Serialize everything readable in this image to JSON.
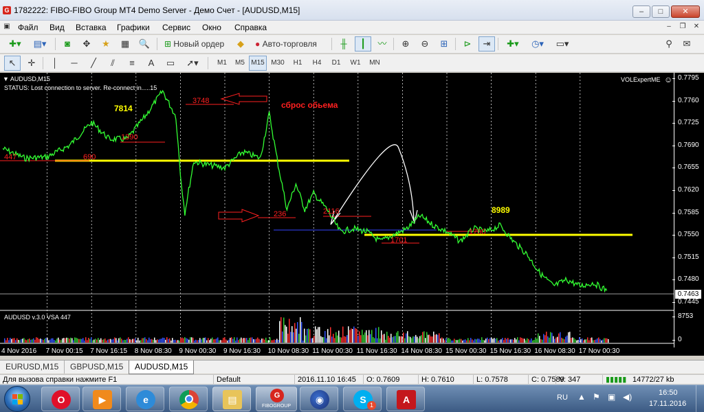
{
  "window": {
    "title": "1782222: FIBO-FIBO Group MT4 Demo Server - Демо Счет - [AUDUSD,M15]",
    "minimize": "–",
    "maximize": "□",
    "close": "✕"
  },
  "menu": [
    "Файл",
    "Вид",
    "Вставка",
    "Графики",
    "Сервис",
    "Окно",
    "Справка"
  ],
  "toolbar": {
    "new_order": "Новый ордер",
    "autotrading": "Авто-торговля",
    "timeframes": [
      "M1",
      "M5",
      "M15",
      "M30",
      "H1",
      "H4",
      "D1",
      "W1",
      "MN"
    ],
    "active_timeframe": "M15"
  },
  "chart": {
    "symbol_label": "AUDUSD,M15",
    "status_line": "STATUS:  Lost connection to server. Re-connect in.....15",
    "expert_label": "VOLExpertME",
    "smiley": "☺",
    "current_price": "0.7463",
    "indicator_label": "AUDUSD v.3.0 VSA 447",
    "volume_max": "8753",
    "volume_zero": "0",
    "annotations": {
      "n7814": "7814",
      "n3748": "3748",
      "reset_volume": "сброс обьема",
      "n1390": "1390",
      "n447": "447",
      "n690": "690",
      "n236": "236",
      "n2116": "2116",
      "n8989": "8989",
      "n1701": "1701",
      "n1700": "1700"
    }
  },
  "chart_data": {
    "type": "line",
    "title": "AUDUSD,M15",
    "y_ticks": [
      "0.7795",
      "0.7760",
      "0.7725",
      "0.7690",
      "0.7655",
      "0.7620",
      "0.7585",
      "0.7550",
      "0.7515",
      "0.7480",
      "0.7445"
    ],
    "x_ticks": [
      "4 Nov 2016",
      "7 Nov 00:15",
      "7 Nov 16:15",
      "8 Nov 08:30",
      "9 Nov 00:30",
      "9 Nov 16:30",
      "10 Nov 08:30",
      "11 Nov 00:30",
      "11 Nov 16:30",
      "14 Nov 08:30",
      "15 Nov 00:30",
      "15 Nov 16:30",
      "16 Nov 08:30",
      "17 Nov 00:30"
    ],
    "ylim": [
      0.7445,
      0.7795
    ],
    "series": [
      {
        "color": "#33ff33",
        "x": [
          0,
          0.5,
          1,
          1.5,
          2,
          2.4,
          2.8,
          3.2,
          3.6,
          3.9,
          4.0,
          4.1,
          4.3,
          4.6,
          5.0,
          5.4,
          5.8,
          6.0,
          6.2,
          6.4,
          6.6,
          6.8,
          7.0,
          7.3,
          7.6,
          7.9,
          8.2,
          8.5,
          8.8,
          9.1,
          9.4,
          9.7,
          10.0,
          10.3,
          10.6,
          10.9,
          11.2,
          11.5,
          11.8,
          12.1,
          12.4,
          12.7,
          13.0,
          13.3,
          13.6
        ],
        "values": [
          0.7685,
          0.767,
          0.7672,
          0.769,
          0.7726,
          0.77,
          0.77,
          0.7735,
          0.7775,
          0.7735,
          0.7645,
          0.7585,
          0.7665,
          0.766,
          0.7655,
          0.768,
          0.767,
          0.774,
          0.766,
          0.759,
          0.763,
          0.759,
          0.7615,
          0.759,
          0.7555,
          0.756,
          0.7555,
          0.754,
          0.755,
          0.756,
          0.758,
          0.7565,
          0.7555,
          0.754,
          0.756,
          0.7555,
          0.7565,
          0.754,
          0.752,
          0.749,
          0.747,
          0.748,
          0.747,
          0.7475,
          0.7463
        ]
      }
    ],
    "grid": true
  },
  "tabs": [
    "EURUSD,M15",
    "GBPUSD,M15",
    "AUDUSD,M15"
  ],
  "active_tab": "AUDUSD,M15",
  "statusbar": {
    "help": "Для вызова справки нажмите F1",
    "profile": "Default",
    "datetime": "2016.11.10 16:45",
    "open": "O: 0.7609",
    "high": "H: 0.7610",
    "low": "L: 0.7578",
    "close": "C: 0.7589",
    "volume": "V: 347",
    "traffic": "14772/27 kb"
  },
  "taskbar": {
    "lang": "RU",
    "time": "16:50",
    "date": "17.11.2016",
    "apps": [
      "opera-icon",
      "media-player-icon",
      "ie-icon",
      "chrome-icon",
      "explorer-icon",
      "fibo-group-icon",
      "firefox-icon",
      "skype-icon",
      "pdf-reader-icon"
    ],
    "fibo_label": "FIBOGROUP",
    "skype_badge": "1"
  },
  "colors": {
    "price_line": "#33ff33",
    "support_line": "#ffff00",
    "chart_bg": "#000000",
    "annotation": "#ff2020"
  }
}
